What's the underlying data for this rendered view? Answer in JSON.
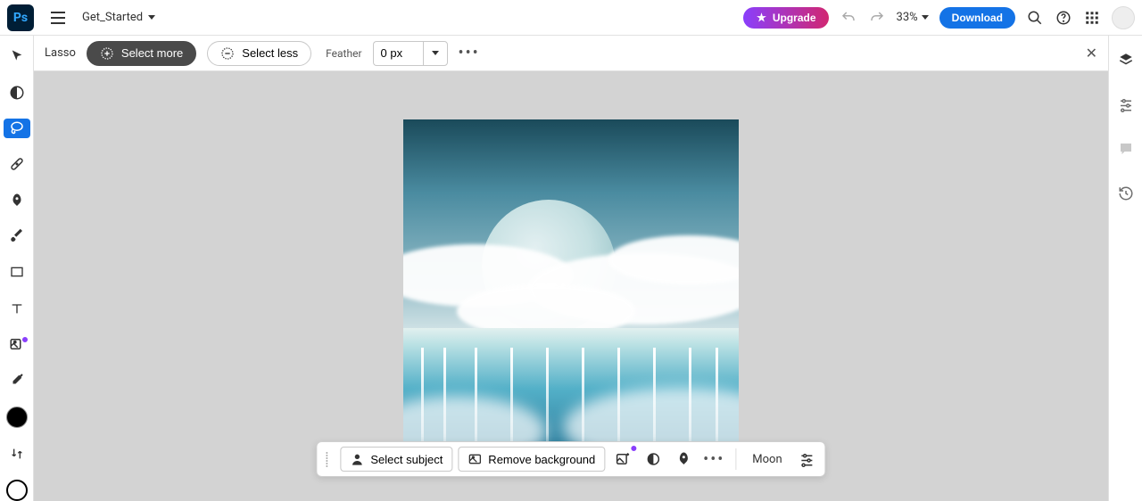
{
  "header": {
    "document_name": "Get_Started",
    "upgrade_label": "Upgrade",
    "zoom_value": "33%",
    "download_label": "Download"
  },
  "options": {
    "tool_name": "Lasso",
    "select_more_label": "Select more",
    "select_less_label": "Select less",
    "feather_label": "Feather",
    "feather_value": "0 px"
  },
  "context_bar": {
    "select_subject_label": "Select subject",
    "remove_bg_label": "Remove background",
    "layer_name": "Moon"
  }
}
